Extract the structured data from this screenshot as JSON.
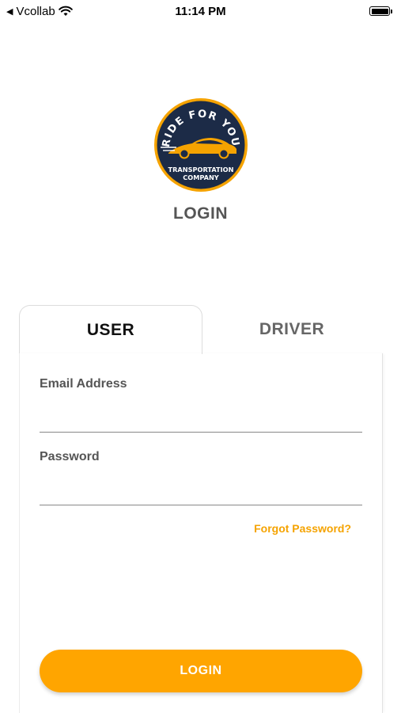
{
  "status_bar": {
    "back_app": "Vcollab",
    "time": "11:14 PM"
  },
  "logo": {
    "top_text": "RIDE FOR YOU",
    "bottom_line1": "TRANSPORTATION",
    "bottom_line2": "COMPANY"
  },
  "page_title": "LOGIN",
  "tabs": [
    {
      "label": "USER",
      "active": true
    },
    {
      "label": "DRIVER",
      "active": false
    }
  ],
  "form": {
    "email_label": "Email Address",
    "email_value": "",
    "password_label": "Password",
    "password_value": "",
    "forgot_label": "Forgot Password?",
    "submit_label": "LOGIN"
  },
  "colors": {
    "accent": "#ffa500",
    "logo_navy": "#1c2b47",
    "logo_gold": "#f5a300"
  }
}
